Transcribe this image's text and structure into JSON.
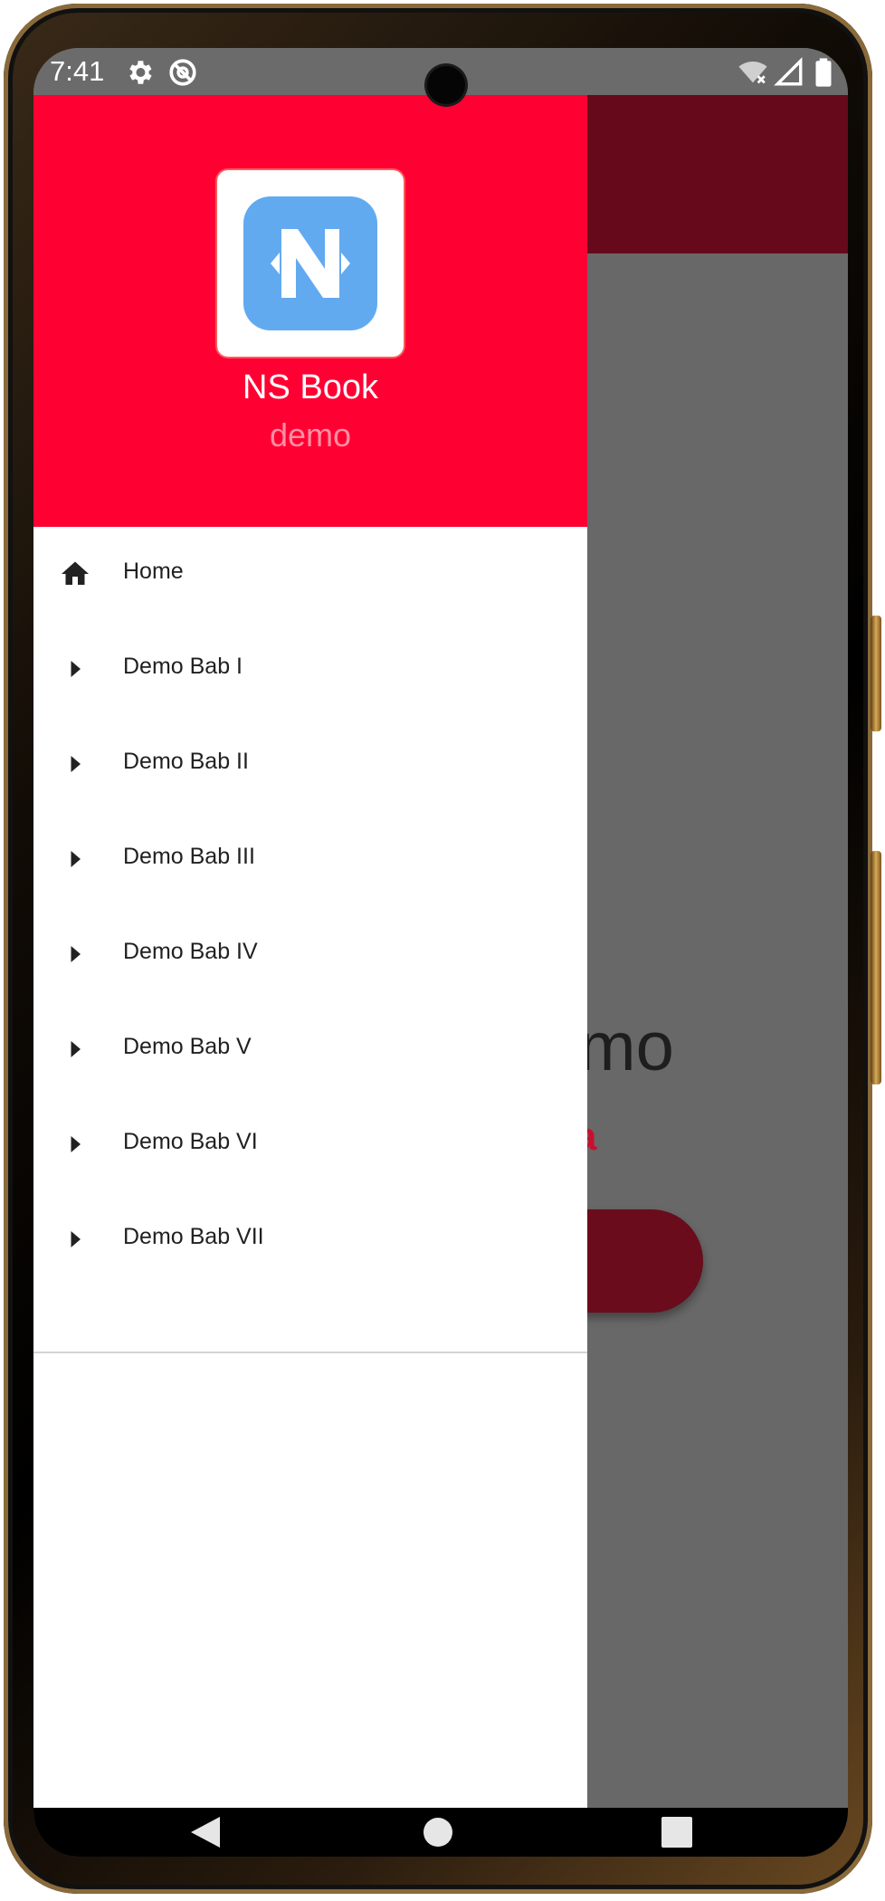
{
  "status_bar": {
    "time": "7:41",
    "left_icons": [
      "gear-icon",
      "sync-disabled-icon"
    ],
    "right_icons": [
      "wifi-off-icon",
      "signal-icon",
      "battery-icon"
    ]
  },
  "drawer": {
    "header": {
      "logo_letter": "N",
      "app_name": "NS Book",
      "app_subtitle": "demo"
    },
    "items": [
      {
        "label": "Home",
        "icon": "home-icon"
      },
      {
        "label": "Demo Bab I",
        "icon": "caret-right-icon"
      },
      {
        "label": "Demo Bab II",
        "icon": "caret-right-icon"
      },
      {
        "label": "Demo Bab III",
        "icon": "caret-right-icon"
      },
      {
        "label": "Demo Bab IV",
        "icon": "caret-right-icon"
      },
      {
        "label": "Demo Bab V",
        "icon": "caret-right-icon"
      },
      {
        "label": "Demo Bab VI",
        "icon": "caret-right-icon"
      },
      {
        "label": "Demo Bab VII",
        "icon": "caret-right-icon"
      }
    ]
  },
  "background": {
    "title_fragment": "emo",
    "subtitle_fragment": "a"
  },
  "nav_bar": [
    "back-icon",
    "home-circle-icon",
    "recents-square-icon"
  ],
  "colors": {
    "header_red": "#ff0033",
    "appbar_dark": "#66091b",
    "logo_blue": "#62aaf0",
    "scrim": "#686868"
  }
}
